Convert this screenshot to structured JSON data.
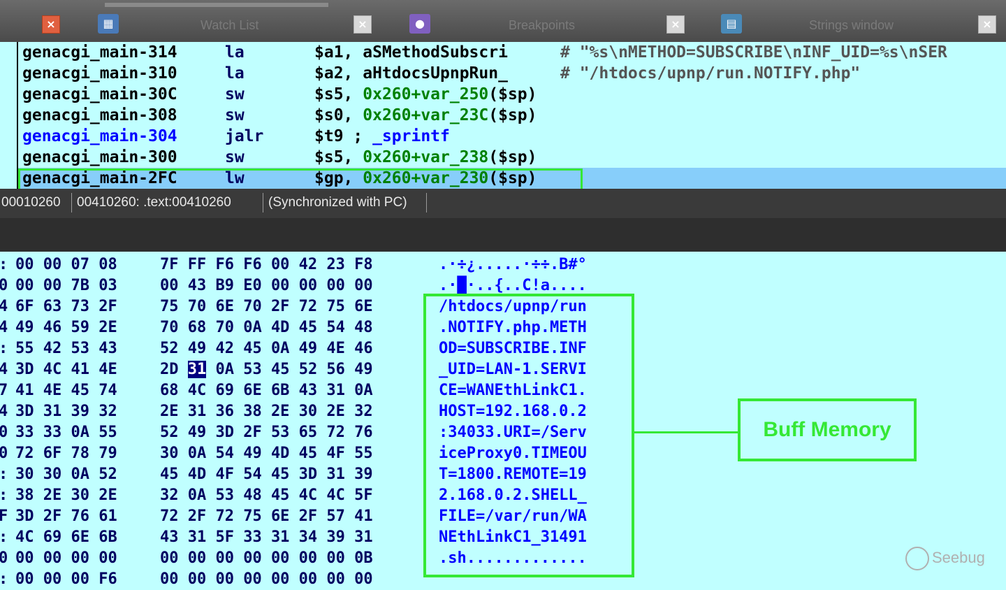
{
  "tabs": [
    {
      "label": "Watch List",
      "icon": "watch-list-icon"
    },
    {
      "label": "Breakpoints",
      "icon": "breakpoints-icon"
    },
    {
      "label": "Strings window",
      "icon": "strings-window-icon"
    }
  ],
  "disassembly": {
    "rows": [
      {
        "label": "genacgi_main-314",
        "mnemonic": "la",
        "operand": "$a1, aSMethodSubscri",
        "comment": "# \"%s\\nMETHOD=SUBSCRIBE\\nINF_UID=%s\\nSER"
      },
      {
        "label": "genacgi_main-310",
        "mnemonic": "la",
        "operand": "$a2, aHtdocsUpnpRun_",
        "comment": "# \"/htdocs/upnp/run.NOTIFY.php\""
      },
      {
        "label": "genacgi_main-30C",
        "mnemonic": "sw",
        "operand_reg": "$s5, ",
        "operand_off": "0x260+var_250",
        "operand_sp": "($sp)"
      },
      {
        "label": "genacgi_main-308",
        "mnemonic": "sw",
        "operand_reg": "$s0, ",
        "operand_off": "0x260+var_23C",
        "operand_sp": "($sp)"
      },
      {
        "label": "genacgi_main-304",
        "mnemonic": "jalr",
        "operand_reg": "$t9 ; ",
        "operand_off": "_sprintf"
      },
      {
        "label": "genacgi_main-300",
        "mnemonic": "sw",
        "operand_reg": "$s5, ",
        "operand_off": "0x260+var_238",
        "operand_sp": "($sp)"
      },
      {
        "label": "genacgi_main-2FC",
        "mnemonic": "lw",
        "operand_reg": "$gp, ",
        "operand_off": "0x260+var_230",
        "operand_sp": "($sp)"
      }
    ]
  },
  "status": {
    "offset": "00010260",
    "address": "00410260: .text:00410260",
    "sync": "(Synchronized with PC)"
  },
  "hex_view": {
    "rows": [
      {
        "addr": ":",
        "bytes1": "00 00 07 08",
        "bytes2": "7F FF F6 F6 00 42 23 F8",
        "ascii": ".·÷¿.....·÷÷.B#°"
      },
      {
        "addr": "0",
        "bytes1": "00 00 7B 03",
        "bytes2": "00 43 B9 E0 00 00 00 00",
        "ascii": ".·█·..{..C!a...."
      },
      {
        "addr": "4",
        "bytes1": "6F 63 73 2F",
        "bytes2": "75 70 6E 70 2F 72 75 6E",
        "ascii": "/htdocs/upnp/run"
      },
      {
        "addr": "4",
        "bytes1": "49 46 59 2E",
        "bytes2": "70 68 70 0A 4D 45 54 48",
        "ascii": ".NOTIFY.php.METH"
      },
      {
        "addr": ":",
        "bytes1": "55 42 53 43",
        "bytes2": "52 49 42 45 0A 49 4E 46",
        "ascii": "OD=SUBSCRIBE.INF"
      },
      {
        "addr": "4",
        "bytes1": "3D 4C 41 4E",
        "bytes2a": "2D ",
        "selected": "31",
        "bytes2b": " 0A 53 45 52 56 49",
        "ascii": "_UID=LAN-1.SERVI"
      },
      {
        "addr": "7",
        "bytes1": "41 4E 45 74",
        "bytes2": "68 4C 69 6E 6B 43 31 0A",
        "ascii": "CE=WANEthLinkC1."
      },
      {
        "addr": "4",
        "bytes1": "3D 31 39 32",
        "bytes2": "2E 31 36 38 2E 30 2E 32",
        "ascii": "HOST=192.168.0.2"
      },
      {
        "addr": "0",
        "bytes1": "33 33 0A 55",
        "bytes2": "52 49 3D 2F 53 65 72 76",
        "ascii": ":34033.URI=/Serv"
      },
      {
        "addr": "0",
        "bytes1": "72 6F 78 79",
        "bytes2": "30 0A 54 49 4D 45 4F 55",
        "ascii": "iceProxy0.TIMEOU"
      },
      {
        "addr": ":",
        "bytes1": "30 30 0A 52",
        "bytes2": "45 4D 4F 54 45 3D 31 39",
        "ascii": "T=1800.REMOTE=19"
      },
      {
        "addr": ":",
        "bytes1": "38 2E 30 2E",
        "bytes2": "32 0A 53 48 45 4C 4C 5F",
        "ascii": "2.168.0.2.SHELL_"
      },
      {
        "addr": "F",
        "bytes1": "3D 2F 76 61",
        "bytes2": "72 2F 72 75 6E 2F 57 41",
        "ascii": "FILE=/var/run/WA"
      },
      {
        "addr": ":",
        "bytes1": "4C 69 6E 6B",
        "bytes2": "43 31 5F 33 31 34 39 31",
        "ascii": "NEthLinkC1_31491"
      },
      {
        "addr": "0",
        "bytes1": "00 00 00 00",
        "bytes2": "00 00 00 00 00 00 00 0B",
        "ascii": ".sh............."
      },
      {
        "addr": ":",
        "bytes1": "00 00 00 F6",
        "bytes2": "00 00 00 00 00 00 00 00",
        "ascii": ""
      }
    ]
  },
  "annotation": {
    "label": "Buff Memory"
  },
  "watermark": {
    "text": "Seebug"
  },
  "colors": {
    "annotation_green": "#35e835",
    "view_bg": "#c0ffff",
    "highlight_row": "#87cefa"
  }
}
